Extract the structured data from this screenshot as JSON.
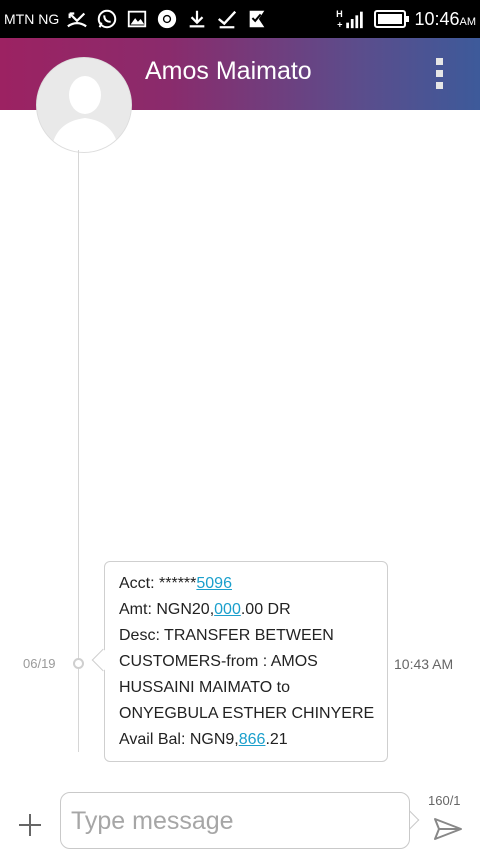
{
  "status_bar": {
    "carrier": "MTN NG",
    "time": "10:46",
    "ampm": "AM",
    "icons": [
      "missed-call-icon",
      "whatsapp-icon",
      "image-icon",
      "chrome-icon",
      "download-icon",
      "check-icon",
      "check-flag-icon",
      "h-plus-icon",
      "signal-icon",
      "battery-icon"
    ]
  },
  "header": {
    "contact_name": "Amos Maimato",
    "menu_icon": "more-vert-icon",
    "avatar_icon": "person-avatar-icon",
    "colors": {
      "start": "#9c2262",
      "end": "#3d5a9a"
    }
  },
  "thread": {
    "date": "06/19",
    "message_time": "10:43 AM",
    "message": {
      "acct_prefix": "Acct: ******",
      "acct_link": "5096",
      "amt_prefix": "Amt: NGN20,",
      "amt_link": "000",
      "amt_suffix": ".00 DR",
      "desc_line1": "Desc: TRANSFER BETWEEN",
      "desc_line2": "CUSTOMERS-from : AMOS",
      "desc_line3": "HUSSAINI MAIMATO to",
      "desc_line4": "ONYEGBULA ESTHER CHINYERE",
      "bal_prefix": "Avail Bal: NGN9,",
      "bal_link": "866",
      "bal_suffix": ".21"
    },
    "link_color": "#1a9fcc"
  },
  "composer": {
    "placeholder": "Type message",
    "counter": "160/1",
    "add_icon": "plus-icon",
    "send_icon": "send-icon"
  }
}
